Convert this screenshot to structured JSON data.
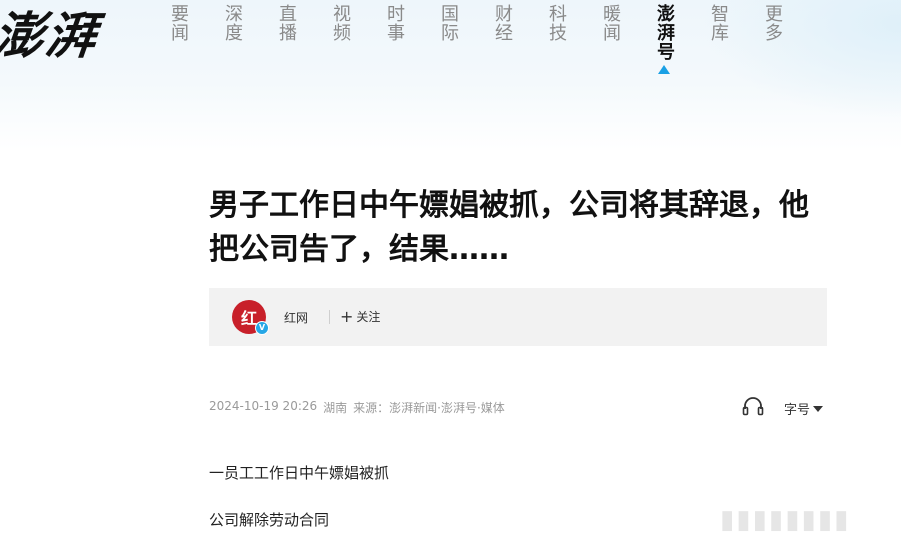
{
  "logo": "澎湃",
  "nav": {
    "items": [
      {
        "label": "要闻",
        "active": false
      },
      {
        "label": "深度",
        "active": false
      },
      {
        "label": "直播",
        "active": false
      },
      {
        "label": "视频",
        "active": false
      },
      {
        "label": "时事",
        "active": false
      },
      {
        "label": "国际",
        "active": false
      },
      {
        "label": "财经",
        "active": false
      },
      {
        "label": "科技",
        "active": false
      },
      {
        "label": "暖闻",
        "active": false
      },
      {
        "label": "澎湃号",
        "active": true
      },
      {
        "label": "智库",
        "active": false
      },
      {
        "label": "更多",
        "active": false
      }
    ],
    "accent_color": "#19a0e5"
  },
  "article": {
    "title": "男子工作日中午嫖娼被抓，公司将其辞退，他把公司告了，结果……",
    "author": {
      "avatar_text": "红",
      "verified_badge": "V",
      "name": "红网",
      "follow_label": "关注"
    },
    "meta": {
      "datetime": "2024-10-19 20:26",
      "location": "湖南",
      "source": "来源：澎湃新闻·澎湃号·媒体"
    },
    "tools": {
      "listen_icon": "headphone-icon",
      "font_size_label": "字号"
    },
    "paragraphs": [
      "一员工工作日中午嫖娼被抓",
      "公司解除劳动合同"
    ]
  }
}
